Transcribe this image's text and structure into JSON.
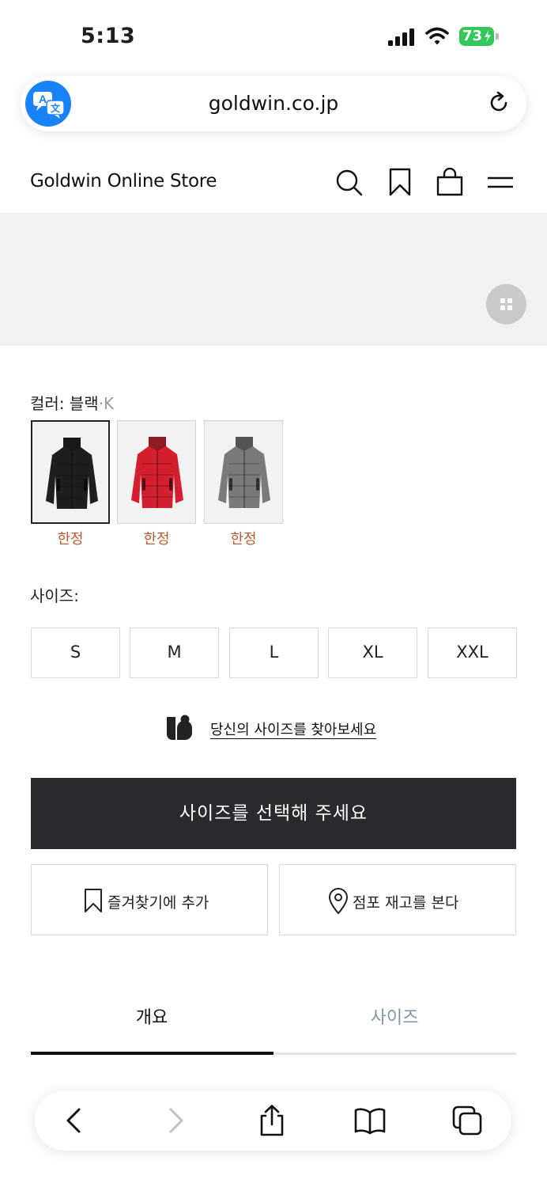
{
  "status_bar": {
    "time": "5:13",
    "battery": "73"
  },
  "browser": {
    "url": "goldwin.co.jp"
  },
  "site": {
    "title": "Goldwin Online Store"
  },
  "color": {
    "label": "컬러: 블랙",
    "code": "·K",
    "swatches": [
      {
        "name": "블랙",
        "color": "#1e1e1e",
        "tag": "한정"
      },
      {
        "name": "레드",
        "color": "#d4202e",
        "tag": "한정"
      },
      {
        "name": "그레이",
        "color": "#7a7a7a",
        "tag": "한정"
      }
    ]
  },
  "size": {
    "label": "사이즈:",
    "options": [
      "S",
      "M",
      "L",
      "XL",
      "XXL"
    ],
    "find_link": "당신의 사이즈를 찾아보세요"
  },
  "actions": {
    "primary": "사이즈를 선택해 주세요",
    "favorite": "즐겨찾기에 추가",
    "store_stock": "점포 재고를 본다"
  },
  "tabs": [
    {
      "label": "개요",
      "active": true
    },
    {
      "label": "사이즈",
      "active": false
    }
  ],
  "colors": {
    "accent_tag": "#b85c38",
    "cta_bg": "#2a2a2e",
    "translate_btn": "#1a82f7",
    "battery": "#34c759"
  }
}
